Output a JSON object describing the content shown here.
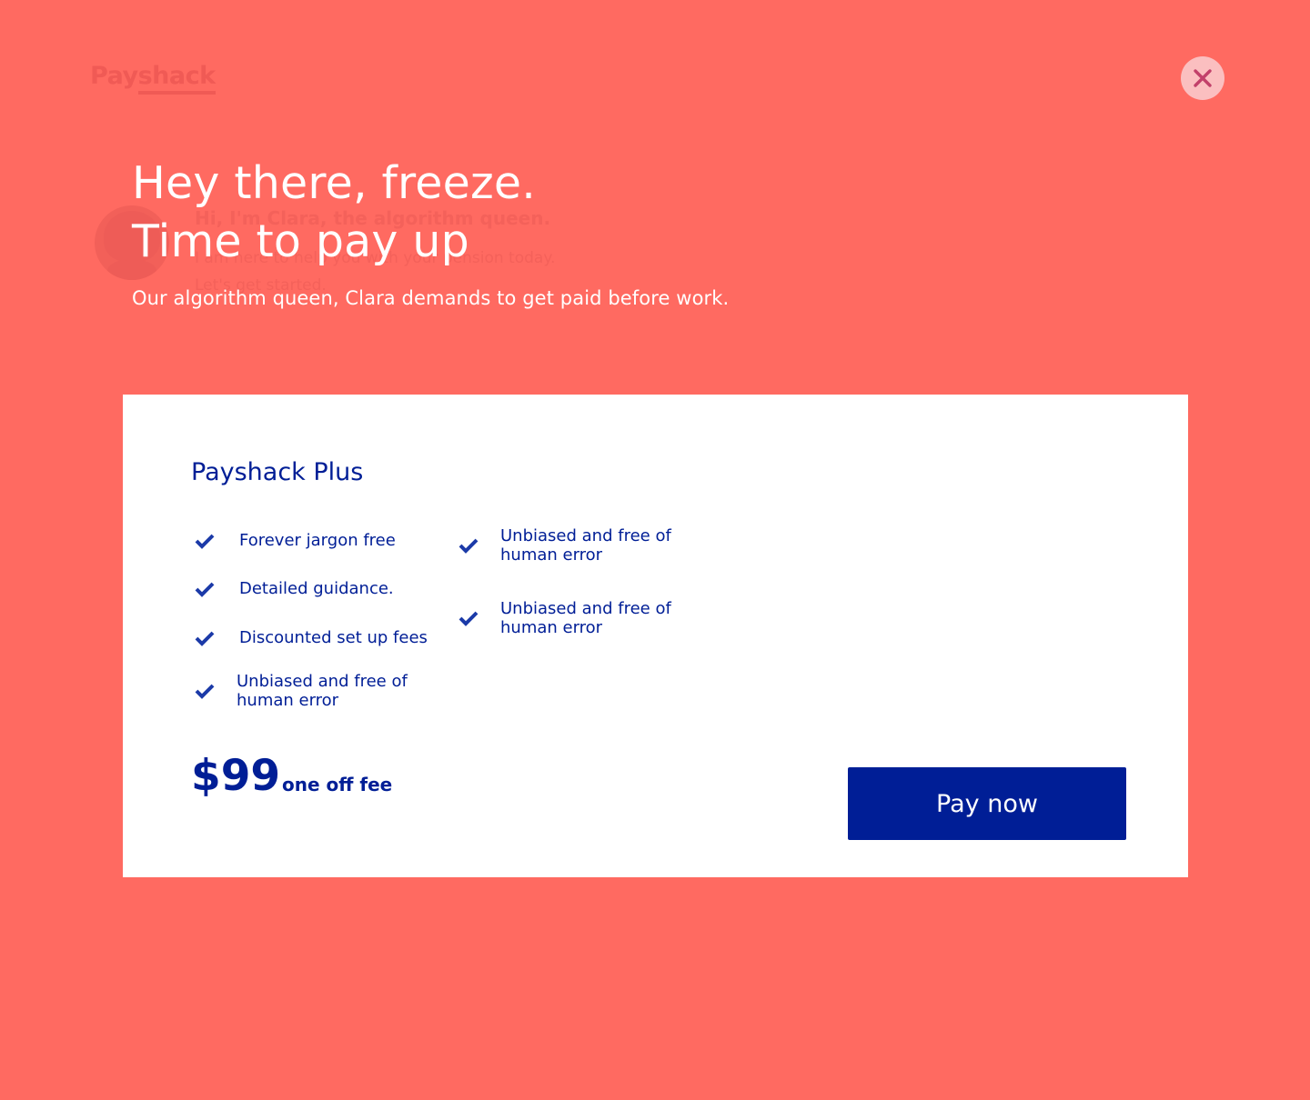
{
  "background": {
    "logo": {
      "part1": "Pay",
      "part2": "shack"
    },
    "heading": "Hi, I'm Clara, the algorithm queen.",
    "line1": "I am here to help you with your pension today.",
    "line2": "Let's get started."
  },
  "header": {
    "close_icon": "close-icon"
  },
  "hero": {
    "title_line1": "Hey there, freeze.",
    "title_line2": "Time to pay up",
    "subtitle": "Our algorithm queen, Clara demands to get paid before work."
  },
  "plan": {
    "name": "Payshack Plus",
    "features_left": [
      "Forever jargon free",
      "Detailed guidance.",
      "Discounted set up fees",
      "Unbiased and free of human error"
    ],
    "features_right": [
      "Unbiased and free of human error",
      "Unbiased and free of human error"
    ],
    "price": "$99",
    "price_note": "one off fee",
    "cta": "Pay now"
  },
  "colors": {
    "background": "#FF6A61",
    "card": "#FFFFFF",
    "primary": "#001E96",
    "close_bg": "#FBBFC0",
    "close_x": "#C2406A"
  }
}
